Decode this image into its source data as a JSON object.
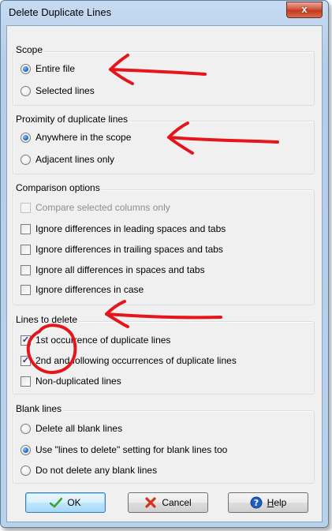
{
  "window": {
    "title": "Delete Duplicate Lines",
    "close_label": "x"
  },
  "scope": {
    "title": "Scope",
    "options": [
      "Entire file",
      "Selected lines"
    ],
    "selected": 0
  },
  "proximity": {
    "title": "Proximity of duplicate lines",
    "options": [
      "Anywhere in the scope",
      "Adjacent lines only"
    ],
    "selected": 0
  },
  "comparison": {
    "title": "Comparison options",
    "options": [
      {
        "label": "Compare selected columns only",
        "checked": false,
        "enabled": false
      },
      {
        "label": "Ignore differences in leading spaces and tabs",
        "checked": false,
        "enabled": true
      },
      {
        "label": "Ignore differences in trailing spaces and tabs",
        "checked": false,
        "enabled": true
      },
      {
        "label": "Ignore all differences in spaces and tabs",
        "checked": false,
        "enabled": true
      },
      {
        "label": "Ignore differences in case",
        "checked": false,
        "enabled": true
      }
    ]
  },
  "lines_to_delete": {
    "title": "Lines to delete",
    "options": [
      {
        "label": "1st occurrence of duplicate lines",
        "checked": true
      },
      {
        "label": "2nd and following occurrences of duplicate lines",
        "checked": true
      },
      {
        "label": "Non-duplicated lines",
        "checked": false
      }
    ]
  },
  "blank_lines": {
    "title": "Blank lines",
    "options": [
      "Delete all blank lines",
      "Use \"lines to delete\" setting for blank lines too",
      "Do not delete any blank lines"
    ],
    "selected": 1
  },
  "buttons": {
    "ok": "OK",
    "cancel": "Cancel",
    "help": "Help"
  },
  "colors": {
    "annotation_red": "#e4161b",
    "ok_check": "#3fa33a",
    "cancel_x": "#d9301e",
    "help_blue": "#1f5fc4"
  }
}
